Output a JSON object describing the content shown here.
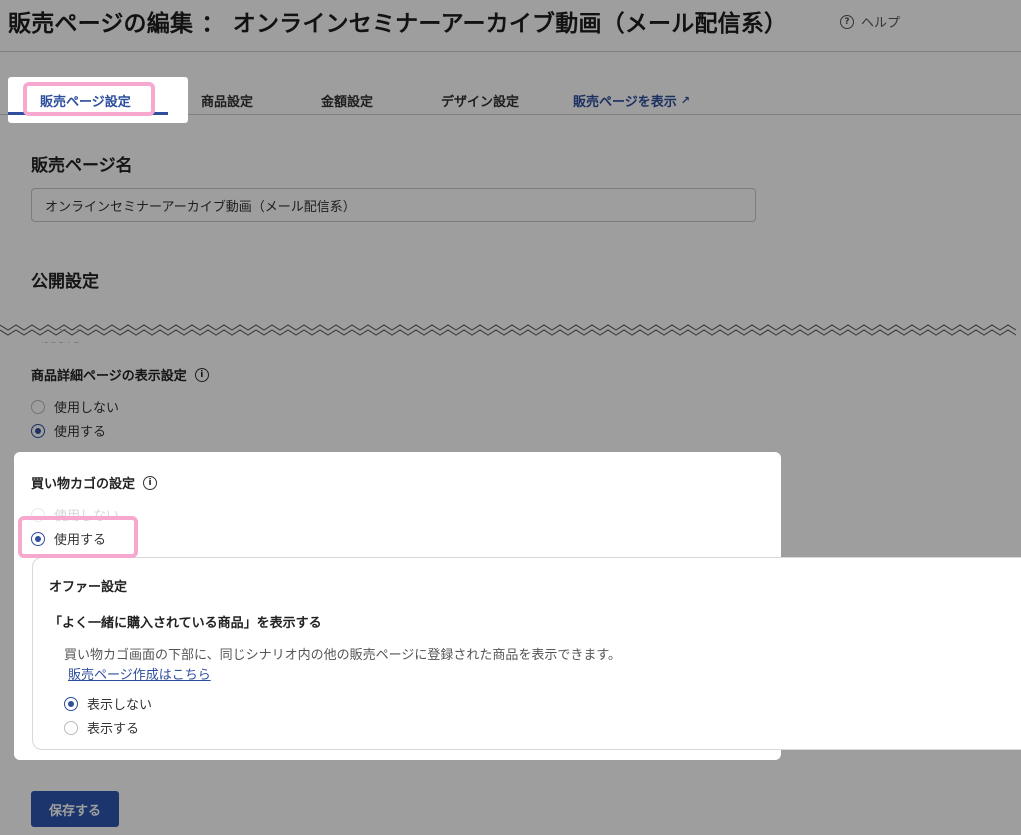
{
  "header": {
    "page_title": "販売ページの編集 ： オンラインセミナーアーカイブ動画（メール配信系）",
    "help_label": "ヘルプ"
  },
  "tabs": [
    {
      "label": "販売ページ設定",
      "active": true
    },
    {
      "label": "商品設定",
      "active": false
    },
    {
      "label": "金額設定",
      "active": false
    },
    {
      "label": "デザイン設定",
      "active": false
    }
  ],
  "tab_link": {
    "label": "販売ページを表示"
  },
  "page_name": {
    "heading": "販売ページ名",
    "value": "オンラインセミナーアーカイブ動画（メール配信系）"
  },
  "publish": {
    "heading": "公開設定",
    "partial_label": "公開状態"
  },
  "product_detail": {
    "label": "商品詳細ページの表示設定",
    "options": [
      "使用しない",
      "使用する"
    ],
    "selected": "使用する"
  },
  "cart": {
    "label": "買い物カゴの設定",
    "options": [
      "使用しない",
      "使用する"
    ],
    "selected": "使用する"
  },
  "offer": {
    "title": "オファー設定",
    "subtitle": "「よく一緒に購入されている商品」を表示する",
    "description": "買い物カゴ画面の下部に、同じシナリオ内の他の販売ページに登録された商品を表示できます。",
    "link": "販売ページ作成はこちら",
    "options": [
      "表示しない",
      "表示する"
    ],
    "selected": "表示しない"
  },
  "actions": {
    "save": "保存する"
  },
  "colors": {
    "accent": "#2e4f9e",
    "button": "#2f56b0",
    "highlight": "#f7a8cf"
  }
}
